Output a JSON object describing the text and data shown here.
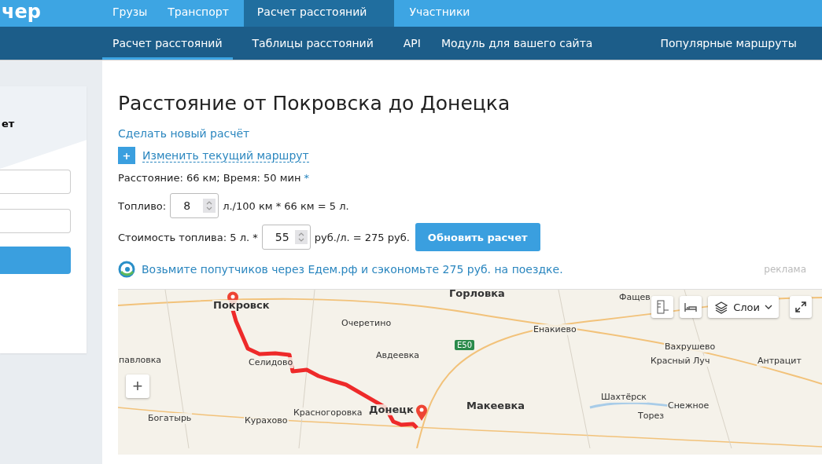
{
  "logo": "чер",
  "top_nav": [
    {
      "label": "Грузы",
      "selected": false
    },
    {
      "label": "Транспорт",
      "selected": false
    },
    {
      "label": "Расчет расстояний",
      "selected": true
    },
    {
      "label": "Участники",
      "selected": false
    }
  ],
  "sub_nav": [
    {
      "label": "Расчет расстояний",
      "selected": true
    },
    {
      "label": "Таблицы расстояний",
      "selected": false
    },
    {
      "label": "API",
      "selected": false
    },
    {
      "label": "Модуль для вашего сайта",
      "selected": false
    },
    {
      "label": "Популярные маршруты",
      "selected": false
    }
  ],
  "sidebar": {
    "heading": "ет"
  },
  "main": {
    "title": "Расстояние от Покровска до Донецка",
    "new_calc_link": "Сделать новый расчёт",
    "expand_icon": "+",
    "edit_route_link": "Изменить текущий маршрут",
    "summary": "Расстояние: 66 км; Время: 50 мин",
    "summary_mark": "*",
    "fuel_label": "Топливо:",
    "fuel_value": "8",
    "fuel_result": "л./100 км * 66 км = 5 л.",
    "cost_label": "Стоимость топлива: 5 л. *",
    "cost_value": "55",
    "cost_result": "руб./л. = 275 руб.",
    "update_button": "Обновить расчет",
    "promo": "Возьмите попутчиков через Едем.рф и сэкономьте 275 руб. на поездке.",
    "ad_label": "реклама"
  },
  "map": {
    "places": [
      "Покровск",
      "Горловка",
      "Фащев",
      "Очеретино",
      "Енакиево",
      "Вахрушево",
      "павловка",
      "Селидово",
      "Авдеевка",
      "Красный Луч",
      "Антрацит",
      "Шахтёрск",
      "Донецк",
      "Макеевка",
      "Снежное",
      "Красногоровка",
      "Богатырь",
      "Курахово",
      "Торез"
    ],
    "road_badge": "E50",
    "layers_button": "Слои",
    "zoom_in": "+"
  }
}
